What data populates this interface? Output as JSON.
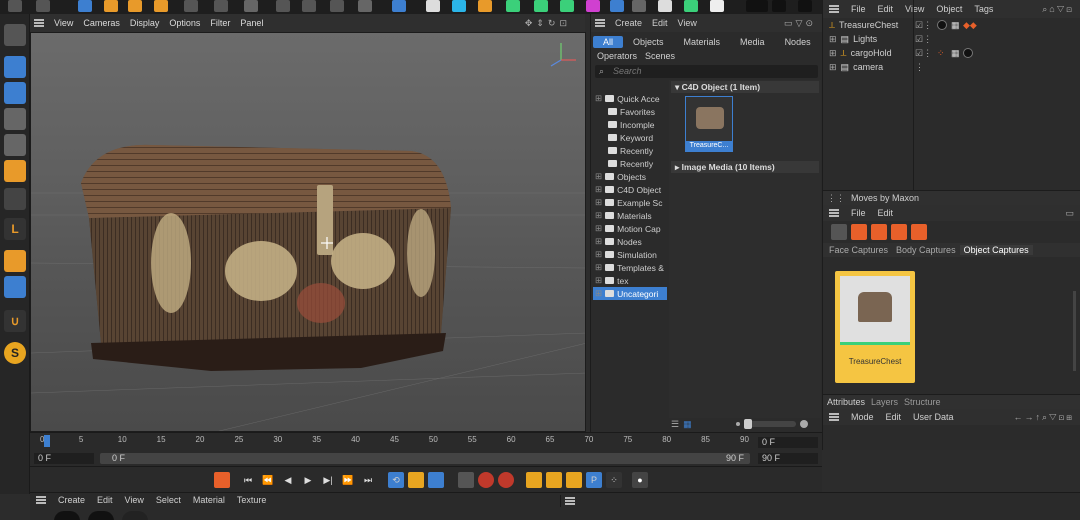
{
  "viewport": {
    "menu": [
      "View",
      "Cameras",
      "Display",
      "Options",
      "Filter",
      "Panel"
    ]
  },
  "asset_browser": {
    "menu": [
      "Create",
      "Edit",
      "View"
    ],
    "tabs": [
      "All",
      "Objects",
      "Materials",
      "Media",
      "Nodes"
    ],
    "tabs2": [
      "Operators",
      "Scenes"
    ],
    "search_placeholder": "Search",
    "tree": [
      {
        "label": "Quick Acce",
        "indent": 0
      },
      {
        "label": "Favorites",
        "indent": 1
      },
      {
        "label": "Incomple",
        "indent": 1
      },
      {
        "label": "Keyword",
        "indent": 1
      },
      {
        "label": "Recently",
        "indent": 1
      },
      {
        "label": "Recently",
        "indent": 1
      },
      {
        "label": "Objects",
        "indent": 0
      },
      {
        "label": "C4D Object",
        "indent": 0
      },
      {
        "label": "Example Sc",
        "indent": 0
      },
      {
        "label": "Materials",
        "indent": 0
      },
      {
        "label": "Motion Cap",
        "indent": 0
      },
      {
        "label": "Nodes",
        "indent": 0
      },
      {
        "label": "Simulation",
        "indent": 0
      },
      {
        "label": "Templates &",
        "indent": 0
      },
      {
        "label": "tex",
        "indent": 0
      },
      {
        "label": "Uncategori",
        "indent": 0
      }
    ],
    "section1": "C4D Object (1 Item)",
    "section2": "Image Media (10 Items)",
    "item_label": "TreasureC..."
  },
  "object_manager": {
    "menu": [
      "File",
      "Edit",
      "View",
      "Object",
      "Tags"
    ],
    "objects": [
      "TreasureChest",
      "Lights",
      "cargoHold",
      "camera"
    ]
  },
  "moves": {
    "title": "Moves by Maxon",
    "menu": [
      "File",
      "Edit"
    ],
    "tabs": [
      "Face Captures",
      "Body Captures",
      "Object Captures"
    ],
    "card_label": "TreasureChest"
  },
  "attributes": {
    "tabs": [
      "Attributes",
      "Layers",
      "Structure"
    ],
    "menu": [
      "Mode",
      "Edit",
      "User Data"
    ]
  },
  "timeline": {
    "ticks": [
      "0",
      "5",
      "10",
      "15",
      "20",
      "25",
      "30",
      "35",
      "40",
      "45",
      "50",
      "55",
      "60",
      "65",
      "70",
      "75",
      "80",
      "85",
      "90"
    ],
    "start_field": "0 F",
    "range_start": "0 F",
    "range_end": "90 F",
    "end_field_1": "0 F",
    "end_field_2": "90 F"
  },
  "material_bar": {
    "menu": [
      "Create",
      "Edit",
      "View",
      "Select",
      "Material",
      "Texture"
    ]
  },
  "colors": {
    "accent_blue": "#3d7fd0",
    "moves_card": "#f5c542",
    "toolbar_bg": "#1e1e1e"
  }
}
